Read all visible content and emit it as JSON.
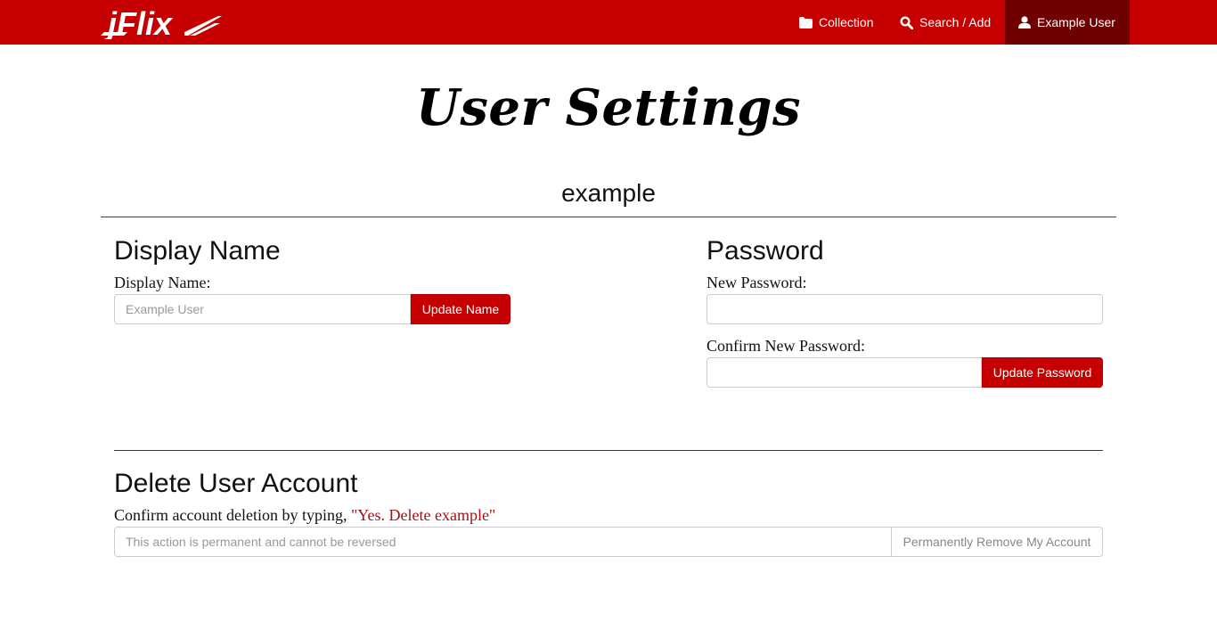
{
  "navbar": {
    "logo_text": "jFlix",
    "items": [
      {
        "label": "Collection",
        "icon": "folder-icon"
      },
      {
        "label": "Search / Add",
        "icon": "search-icon"
      },
      {
        "label": "Example User",
        "icon": "user-icon",
        "active": true
      }
    ]
  },
  "page": {
    "title": "User Settings",
    "username": "example"
  },
  "display_name_section": {
    "title": "Display Name",
    "label": "Display Name:",
    "placeholder": "Example User",
    "button": "Update Name"
  },
  "password_section": {
    "title": "Password",
    "new_label": "New Password:",
    "confirm_label": "Confirm New Password:",
    "button": "Update Password"
  },
  "delete_section": {
    "title": "Delete User Account",
    "instruction_prefix": "Confirm account deletion by typing, ",
    "confirm_phrase": "\"Yes. Delete example\"",
    "placeholder": "This action is permanent and cannot be reversed",
    "button": "Permanently Remove My Account"
  },
  "colors": {
    "brand": "#c60000",
    "nav_active": "#6e0000",
    "rule": "#a31212"
  }
}
